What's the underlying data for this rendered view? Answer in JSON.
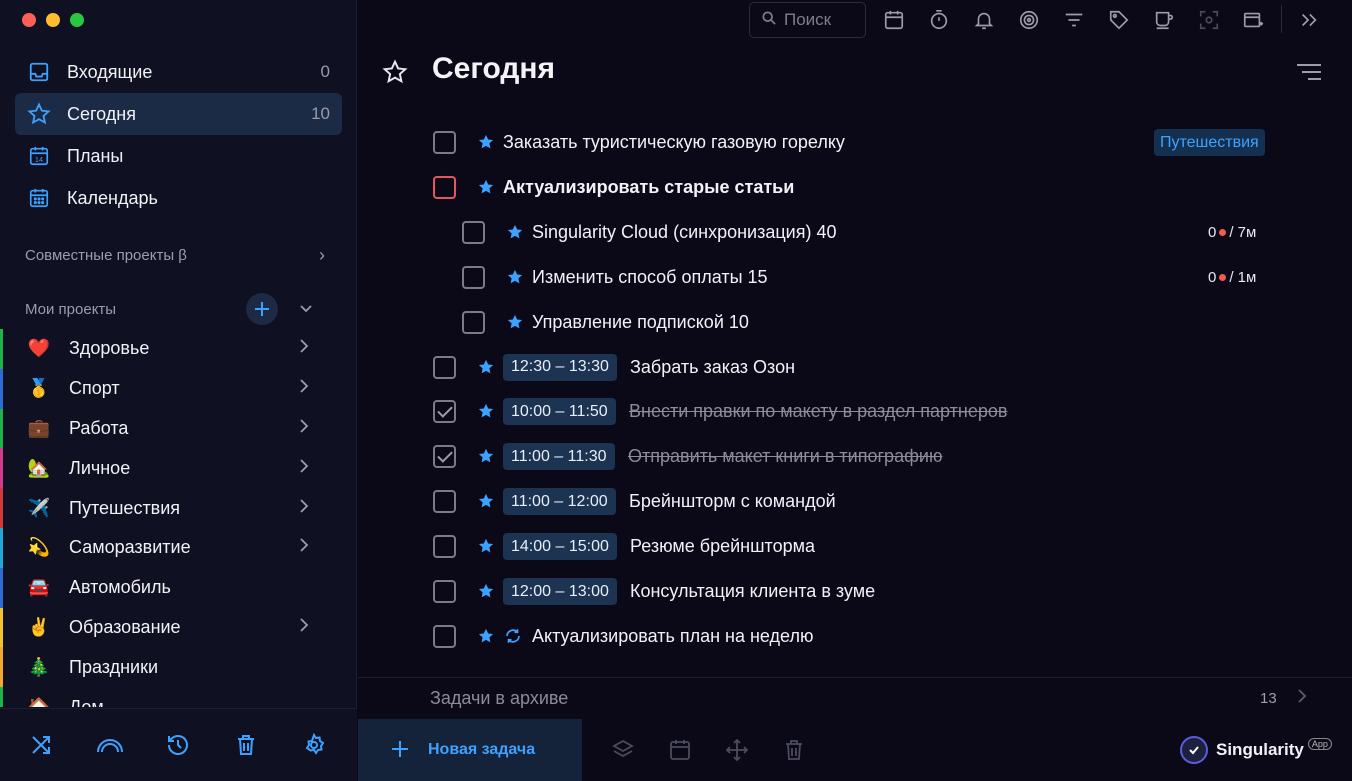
{
  "sidebar": {
    "nav": [
      {
        "label": "Входящие",
        "count": "0",
        "icon": "inbox-icon"
      },
      {
        "label": "Сегодня",
        "count": "10",
        "icon": "star-icon"
      },
      {
        "label": "Планы",
        "count": "",
        "icon": "calendar-14-icon"
      },
      {
        "label": "Календарь",
        "count": "",
        "icon": "calendar-grid-icon"
      }
    ],
    "shared_projects": "Совместные проекты β",
    "my_projects": "Мои проекты",
    "projects": [
      {
        "emoji": "❤️",
        "label": "Здоровье",
        "color": "#1fb34a",
        "has_children": true
      },
      {
        "emoji": "🥇",
        "label": "Спорт",
        "color": "#2e6bd6",
        "has_children": true
      },
      {
        "emoji": "💼",
        "label": "Работа",
        "color": "#1fb34a",
        "has_children": true
      },
      {
        "emoji": "🏡",
        "label": "Личное",
        "color": "#d23a8c",
        "has_children": true
      },
      {
        "emoji": "✈️",
        "label": "Путешествия",
        "color": "#d23a3a",
        "has_children": true
      },
      {
        "emoji": "💫",
        "label": "Саморазвитие",
        "color": "#23a6d8",
        "has_children": true
      },
      {
        "emoji": "🚘",
        "label": "Автомобиль",
        "color": "#2e6bd6",
        "has_children": false
      },
      {
        "emoji": "✌️",
        "label": "Образование",
        "color": "#f1c232",
        "has_children": true
      },
      {
        "emoji": "🎄",
        "label": "Праздники",
        "color": "#f1a832",
        "has_children": false
      },
      {
        "emoji": "🏠",
        "label": "Дом",
        "color": "#1fb34a",
        "has_children": false
      }
    ],
    "footer_icons": [
      "shuffle-icon",
      "rainbow-icon",
      "history-icon",
      "trash-icon",
      "settings-icon"
    ]
  },
  "toolbar": {
    "search_placeholder": "Поиск",
    "icons": [
      "calendar-icon",
      "timer-icon",
      "bell-icon",
      "target-icon",
      "filter-icon",
      "tag-icon",
      "cup-icon",
      "focus-icon",
      "add-window-icon",
      "collapse-right-icon"
    ]
  },
  "main": {
    "title": "Сегодня",
    "tasks": [
      {
        "text": "Заказать туристическую газовую горелку",
        "tag": "Путешествия",
        "indent": 0,
        "checked": false,
        "bold": false,
        "red": false
      },
      {
        "text": "Актуализировать старые статьи",
        "indent": 0,
        "checked": false,
        "bold": true,
        "red": true
      },
      {
        "text": "Singularity Cloud (синхронизация) 40",
        "indent": 1,
        "meta_count": "0",
        "meta_time": "/ 7м",
        "checked": false
      },
      {
        "text": "Изменить способ оплаты 15",
        "indent": 1,
        "meta_count": "0",
        "meta_time": "/ 1м",
        "checked": false
      },
      {
        "text": "Управление подпиской 10",
        "indent": 1,
        "checked": false
      },
      {
        "time": "12:30 – 13:30",
        "text": "Забрать заказ Озон",
        "indent": 0,
        "checked": false
      },
      {
        "time": "10:00 – 11:50",
        "text": "Внести правки по макету в раздел партнеров",
        "indent": 0,
        "checked": true
      },
      {
        "time": "11:00 – 11:30",
        "text": "Отправить макет книги в типографию",
        "indent": 0,
        "checked": true
      },
      {
        "time": "11:00 – 12:00",
        "text": "Брейншторм с командой",
        "indent": 0,
        "checked": false
      },
      {
        "time": "14:00 – 15:00",
        "text": "Резюме брейншторма",
        "indent": 0,
        "checked": false
      },
      {
        "time": "12:00 – 13:00",
        "text": "Консультация клиента в зуме",
        "indent": 0,
        "checked": false
      },
      {
        "text": "Актуализировать план на неделю",
        "indent": 0,
        "checked": false,
        "recurring": true
      }
    ],
    "archive_label": "Задачи в архиве",
    "archive_count": "13",
    "new_task": "Новая задача",
    "brand": "Singularity",
    "brand_badge": "App"
  }
}
